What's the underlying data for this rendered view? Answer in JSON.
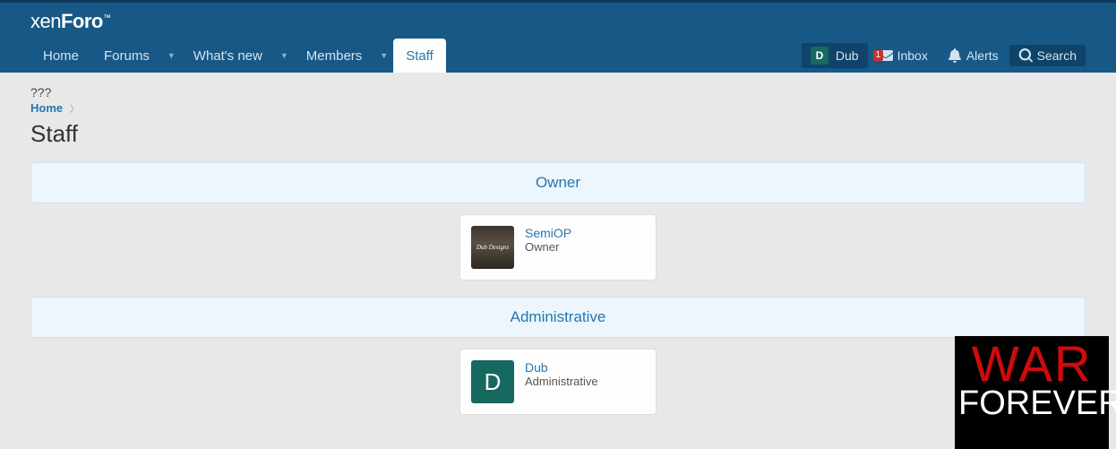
{
  "logo": {
    "part1": "xen",
    "part2": "Foro"
  },
  "nav": {
    "items": [
      {
        "label": "Home",
        "has_toggle": false,
        "active": false
      },
      {
        "label": "Forums",
        "has_toggle": true,
        "active": false
      },
      {
        "label": "What's new",
        "has_toggle": true,
        "active": false
      },
      {
        "label": "Members",
        "has_toggle": true,
        "active": false
      },
      {
        "label": "Staff",
        "has_toggle": false,
        "active": true
      }
    ],
    "user": {
      "initial": "D",
      "name": "Dub"
    },
    "inbox": {
      "label": "Inbox",
      "badge": "1"
    },
    "alerts": {
      "label": "Alerts"
    },
    "search": {
      "label": "Search"
    }
  },
  "page": {
    "pre": "???",
    "breadcrumb": "Home",
    "title": "Staff"
  },
  "groups": [
    {
      "title": "Owner",
      "members": [
        {
          "name": "SemiOP",
          "role": "Owner",
          "avatar_type": "image",
          "initial": ""
        }
      ]
    },
    {
      "title": "Administrative",
      "members": [
        {
          "name": "Dub",
          "role": "Administrative",
          "avatar_type": "letter",
          "initial": "D"
        }
      ]
    }
  ],
  "floating": {
    "line1": "WAR",
    "line2": "FOREVER"
  }
}
